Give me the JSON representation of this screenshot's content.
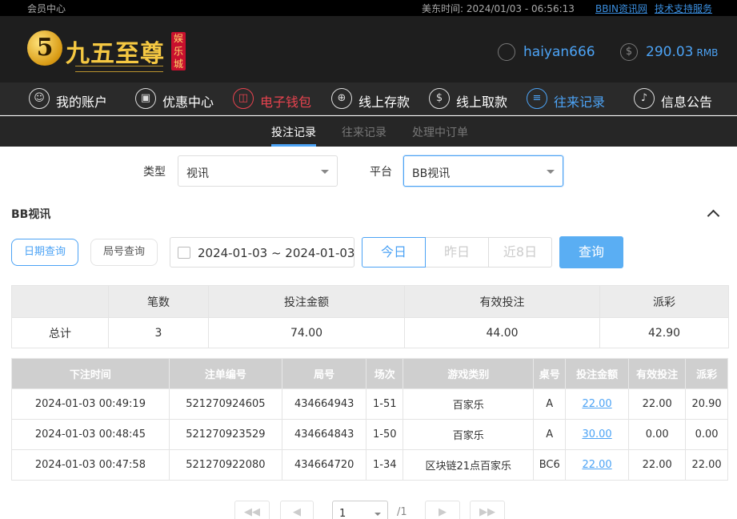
{
  "topbar": {
    "member_center": "会员中心",
    "time_label": "美东时间:",
    "time_value": "2024/01/03 - 06:56:13",
    "link_bbin": "BBIN资讯网",
    "link_support": "技术支持服务"
  },
  "header": {
    "logo_digit": "5",
    "logo_name": "九五至尊",
    "logo_stamp": "娱乐城",
    "username": "haiyan666",
    "balance": "290.03",
    "currency": "RMB",
    "balance_icon": "$"
  },
  "nav": [
    {
      "label": "我的账户",
      "icon": "user-icon",
      "glyph": "☺"
    },
    {
      "label": "优惠中心",
      "icon": "gift-icon",
      "glyph": "▣"
    },
    {
      "label": "电子钱包",
      "icon": "wallet-icon",
      "glyph": "◫"
    },
    {
      "label": "线上存款",
      "icon": "deposit-icon",
      "glyph": "⊕"
    },
    {
      "label": "线上取款",
      "icon": "withdraw-icon",
      "glyph": "$"
    },
    {
      "label": "往来记录",
      "icon": "records-icon",
      "glyph": "≡"
    },
    {
      "label": "信息公告",
      "icon": "bell-icon",
      "glyph": "♪"
    }
  ],
  "subnav": [
    "投注记录",
    "往来记录",
    "处理中订单"
  ],
  "filters": {
    "type_label": "类型",
    "type_value": "视讯",
    "platform_label": "平台",
    "platform_value": "BB视讯"
  },
  "section_title": "BB视讯",
  "query": {
    "date_query": "日期查询",
    "round_query": "局号查询",
    "date_range": "2024-01-03 ~ 2024-01-03",
    "today": "今日",
    "yesterday": "昨日",
    "last8": "近8日",
    "search": "查询"
  },
  "summary": {
    "headers": [
      "",
      "笔数",
      "投注金额",
      "有效投注",
      "派彩"
    ],
    "row": [
      "总计",
      "3",
      "74.00",
      "44.00",
      "42.90"
    ]
  },
  "details": {
    "headers": [
      "下注时间",
      "注单编号",
      "局号",
      "场次",
      "游戏类别",
      "桌号",
      "投注金额",
      "有效投注",
      "派彩"
    ],
    "rows": [
      [
        "2024-01-03 00:49:19",
        "521270924605",
        "434664943",
        "1-51",
        "百家乐",
        "A",
        "22.00",
        "22.00",
        "20.90"
      ],
      [
        "2024-01-03 00:48:45",
        "521270923529",
        "434664843",
        "1-50",
        "百家乐",
        "A",
        "30.00",
        "0.00",
        "0.00"
      ],
      [
        "2024-01-03 00:47:58",
        "521270922080",
        "434664720",
        "1-34",
        "区块链21点百家乐",
        "BC6",
        "22.00",
        "22.00",
        "22.00"
      ]
    ]
  },
  "pagination": {
    "first": "◀◀",
    "prev": "◀",
    "page": "1",
    "total": "/1",
    "next": "▶",
    "last": "▶▶"
  },
  "colors": {
    "accent": "#4ca3f5",
    "header_bg": "#1e1e1e",
    "nav_active_red": "#e8434f"
  }
}
